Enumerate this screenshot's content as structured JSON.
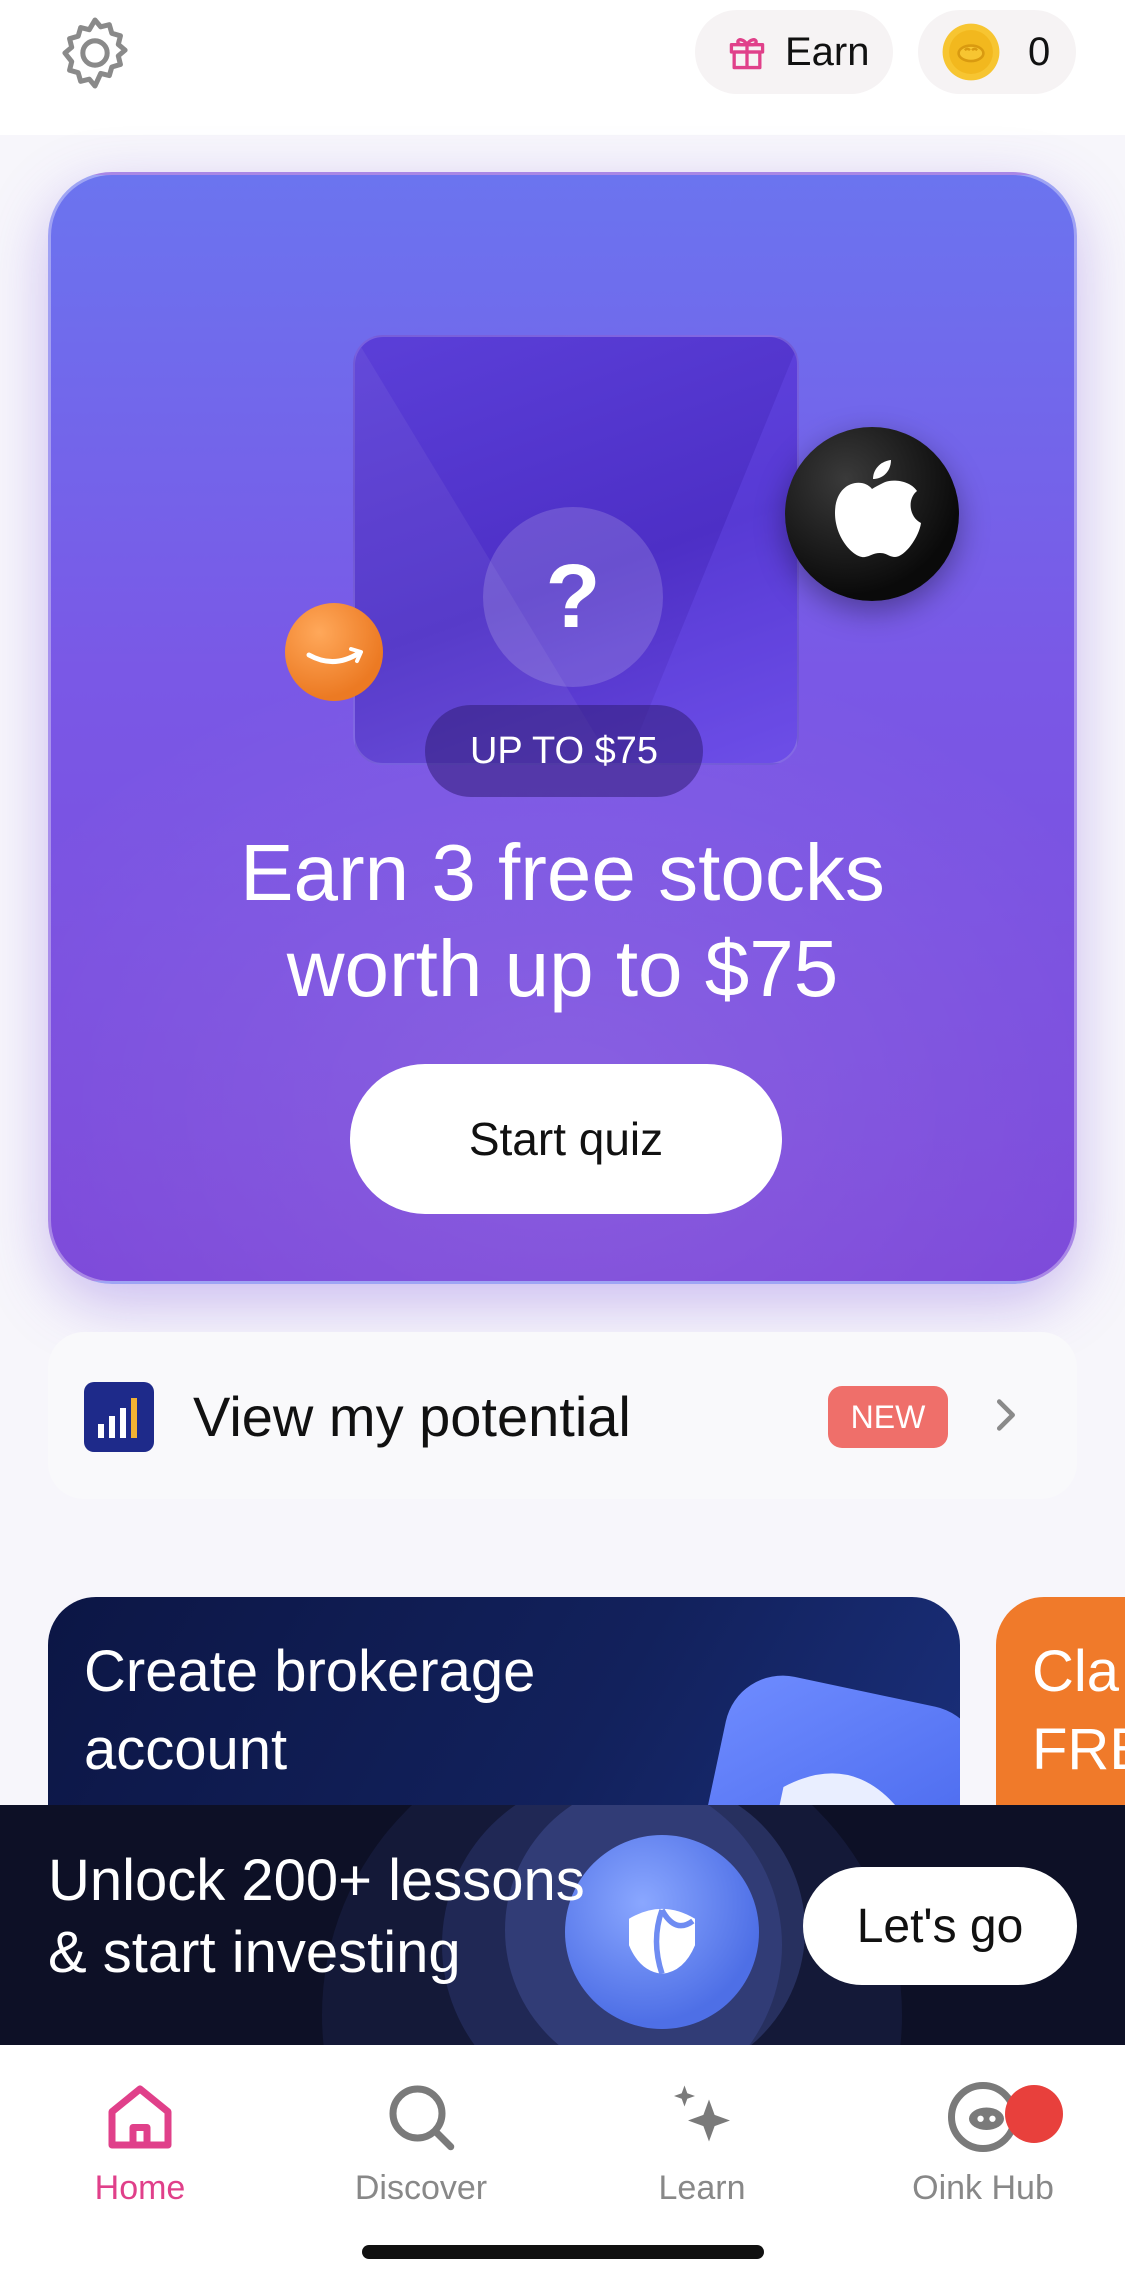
{
  "header": {
    "earn_label": "Earn",
    "coin_count": "0"
  },
  "promo": {
    "badge": "UP TO $75",
    "headline_line1": "Earn 3 free stocks",
    "headline_line2": "worth up to $75",
    "cta_label": "Start quiz",
    "question_mark": "?"
  },
  "potential": {
    "label": "View my potential",
    "badge": "NEW"
  },
  "carousel": {
    "brokerage_line1": "Create brokerage",
    "brokerage_line2": "account",
    "claim_line1": "Cla",
    "claim_line2": "FRE"
  },
  "banner": {
    "line1": "Unlock 200+ lessons",
    "line2": "& start investing",
    "cta_label": "Let's go"
  },
  "tabs": [
    {
      "label": "Home",
      "icon": "home-icon",
      "active": true
    },
    {
      "label": "Discover",
      "icon": "search-icon",
      "active": false
    },
    {
      "label": "Learn",
      "icon": "sparkle-icon",
      "active": false
    },
    {
      "label": "Oink Hub",
      "icon": "pig-icon",
      "active": false
    }
  ],
  "colors": {
    "accent_pink": "#e0408a",
    "promo_purple": "#7a58e6",
    "new_badge": "#ef6f6a",
    "claim_orange": "#f07a2a",
    "notification_red": "#e8403c"
  }
}
